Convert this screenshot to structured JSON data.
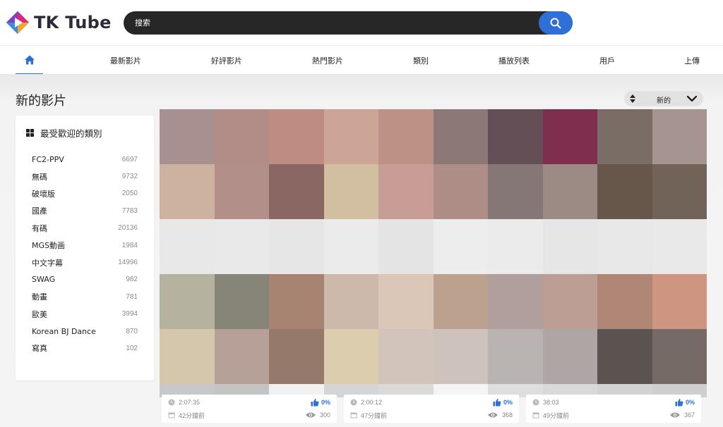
{
  "brand": {
    "name": "TK Tube",
    "accent": "#2f6fd8"
  },
  "search": {
    "placeholder": "搜索"
  },
  "nav": {
    "items": [
      {
        "label": "最新影片"
      },
      {
        "label": "好評影片"
      },
      {
        "label": "熱門影片"
      },
      {
        "label": "類別"
      },
      {
        "label": "播放列表"
      },
      {
        "label": "用戶"
      },
      {
        "label": "上傳"
      }
    ]
  },
  "main": {
    "title": "新的影片",
    "sort_label": "新的"
  },
  "sidebar": {
    "title": "最受歡迎的類別",
    "categories": [
      {
        "name": "FC2-PPV",
        "count": "6697"
      },
      {
        "name": "無碼",
        "count": "9732"
      },
      {
        "name": "破壞版",
        "count": "2050"
      },
      {
        "name": "國產",
        "count": "7783"
      },
      {
        "name": "有碼",
        "count": "20136"
      },
      {
        "name": "MGS動画",
        "count": "1984"
      },
      {
        "name": "中文字幕",
        "count": "14996"
      },
      {
        "name": "SWAG",
        "count": "982"
      },
      {
        "name": "動畫",
        "count": "781"
      },
      {
        "name": "歐美",
        "count": "3994"
      },
      {
        "name": "Korean BJ Dance",
        "count": "870"
      },
      {
        "name": "寫真",
        "count": "102"
      }
    ]
  },
  "videos": [
    {
      "duration": "2:07:35",
      "age": "42分鐘前",
      "likes": "0%",
      "views": "300"
    },
    {
      "duration": "2:00:12",
      "age": "47分鐘前",
      "likes": "0%",
      "views": "368"
    },
    {
      "duration": "38:03",
      "age": "49分鐘前",
      "likes": "0%",
      "views": "367"
    }
  ],
  "thumbnail_mosaic_colors": [
    "#a99090",
    "#b28c87",
    "#bf8c82",
    "#cda597",
    "#bd9186",
    "#8d7878",
    "#634f55",
    "#7f2f4d",
    "#7a6d66",
    "#a69490",
    "#cdb29f",
    "#b28f88",
    "#8b6763",
    "#d2bea0",
    "#c79d96",
    "#ad8d85",
    "#857776",
    "#9c8a84",
    "#66574a",
    "#716358",
    "#e8e8e8",
    "#e9e9e9",
    "#e6e6e6",
    "#ebebeb",
    "#e4e4e4",
    "#ededed",
    "#ebebeb",
    "#e6e6e6",
    "#e8e8e8",
    "#e9e9e9",
    "#b6b2a0",
    "#878478",
    "#a78472",
    "#cdb8ac",
    "#dbc7b8",
    "#bda18f",
    "#b09f9c",
    "#bd9e95",
    "#b08677",
    "#ce9580",
    "#d5c7ab",
    "#b7a097",
    "#95796b",
    "#dccdaf",
    "#d2c4bb",
    "#cdc3bc",
    "#b9b3b2",
    "#aea6a5",
    "#5b5350",
    "#766a67",
    "#c8c8c8",
    "#c4c4c4",
    "#f1f1f1",
    "#d5d5d5",
    "#dadada",
    "#f4f4f4",
    "#dedede",
    "#d9d9d9",
    "#d3d3d3",
    "#cfcfcf"
  ]
}
